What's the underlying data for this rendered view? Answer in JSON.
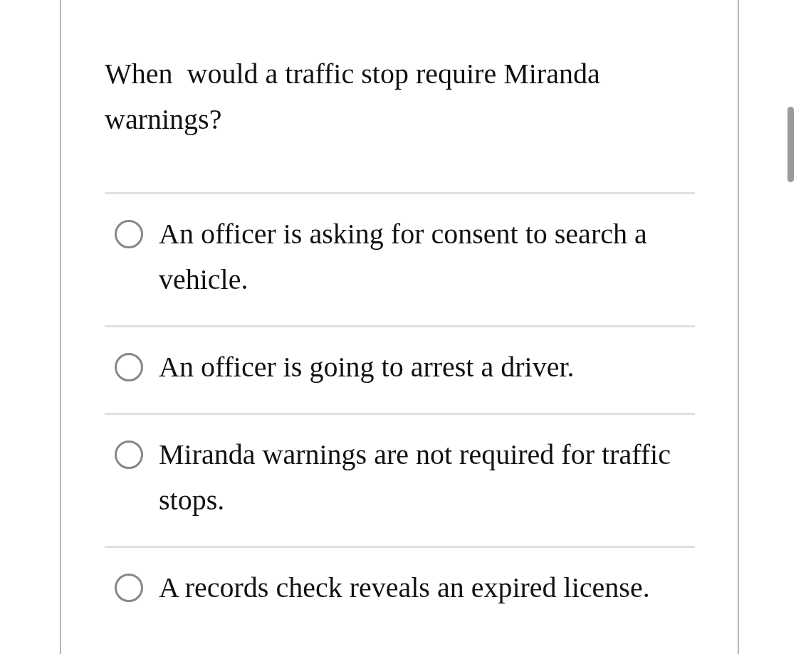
{
  "question": "When  would a traffic stop require Miranda warnings?",
  "options": [
    {
      "label": "An officer is asking for consent to search a vehicle.",
      "selected": false
    },
    {
      "label": "An officer is going to arrest a driver.",
      "selected": false
    },
    {
      "label": "Miranda warnings are not required for traffic stops.",
      "selected": false
    },
    {
      "label": "A records check reveals an expired license.",
      "selected": false
    }
  ]
}
